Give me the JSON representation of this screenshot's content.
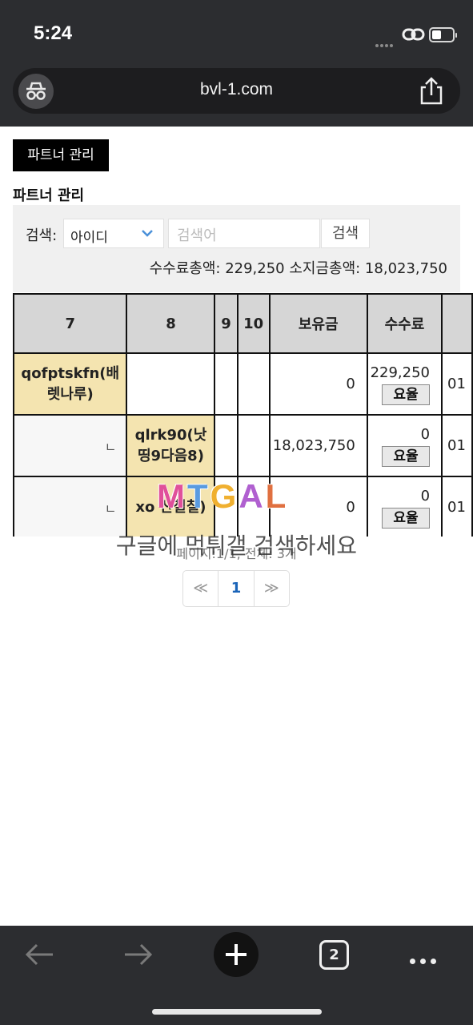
{
  "status_bar": {
    "time": "5:24"
  },
  "browser": {
    "url": "bvl-1.com",
    "tab_count": "2"
  },
  "page": {
    "header_button": "파트너 관리",
    "section_title": "파트너 관리",
    "search": {
      "label": "검색:",
      "select_value": "아이디",
      "input_placeholder": "검색어",
      "button_label": "검색"
    },
    "totals": "수수료총액: 229,250 소지금총액: 18,023,750",
    "table": {
      "headers": [
        "7",
        "8",
        "9",
        "10",
        "보유금",
        "수수료",
        ""
      ],
      "rows": [
        {
          "c7": "qofptskfn(배렛나루)",
          "c8": "",
          "balance": "0",
          "fee": "229,250",
          "rate": "요율",
          "cut": "01"
        },
        {
          "c7": "ㄴ",
          "c8": "qlrk90(낫띵9다음8)",
          "balance": "18,023,750",
          "fee": "0",
          "rate": "요율",
          "cut": "01"
        },
        {
          "c7": "ㄴ",
          "c8": "xo 산칠칠)",
          "balance": "0",
          "fee": "0",
          "rate": "요율",
          "cut": "01"
        }
      ]
    },
    "page_info": "페이지:1/1, 전체: 3개",
    "pagination": {
      "prev": "≪",
      "current": "1",
      "next": "≫"
    }
  },
  "watermark": {
    "logo": "MTGAL",
    "text": "구글에 먹튀갤 검색하세요"
  }
}
